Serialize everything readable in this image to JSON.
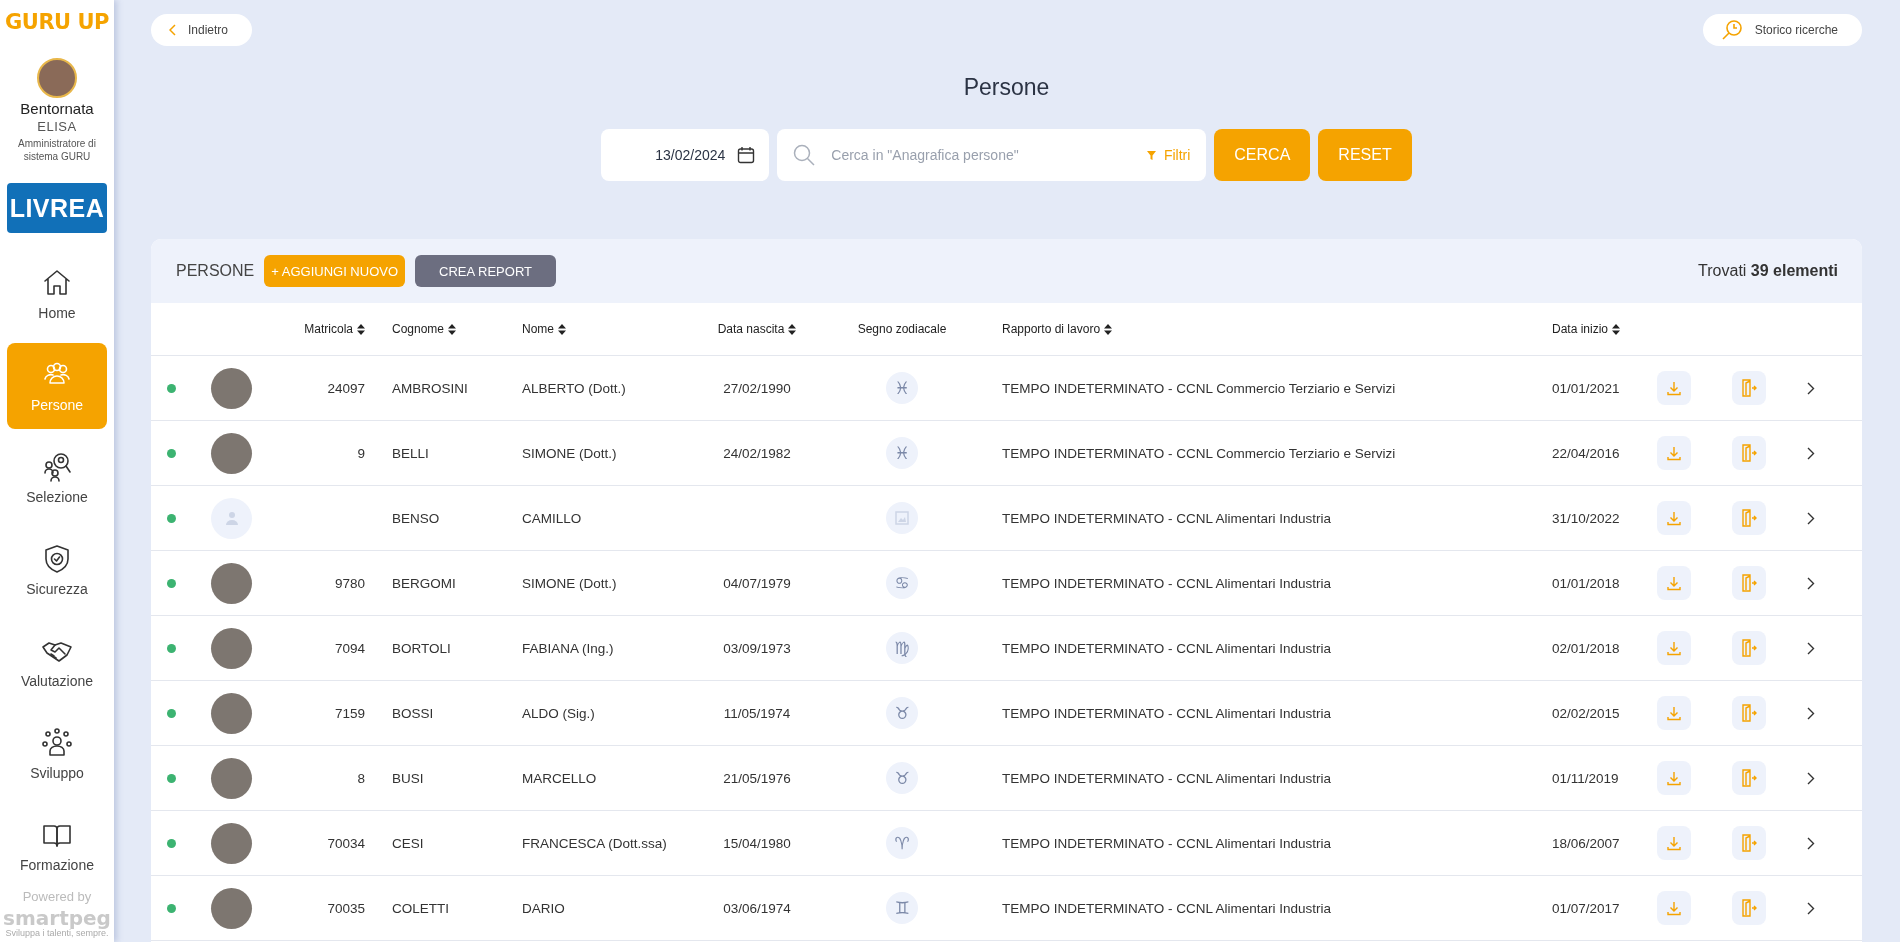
{
  "sidebar": {
    "logo": "GURU UP",
    "greeting": "Bentornata",
    "user_name": "ELISA",
    "user_role": "Amministratore di sistema GURU",
    "company_logo": "LIVREA",
    "items": [
      {
        "label": "Home",
        "kind": "home",
        "selected": false
      },
      {
        "label": "Persone",
        "kind": "people",
        "selected": true
      },
      {
        "label": "Selezione",
        "kind": "recruiting",
        "selected": false
      },
      {
        "label": "Sicurezza",
        "kind": "safety",
        "selected": false
      },
      {
        "label": "Valutazione",
        "kind": "evaluation",
        "selected": false
      },
      {
        "label": "Sviluppo",
        "kind": "development",
        "selected": false
      },
      {
        "label": "Formazione",
        "kind": "training",
        "selected": false
      }
    ],
    "powered_by": "Powered by",
    "brand": "smartpeg",
    "brand_tagline": "Sviluppa i talenti, sempre."
  },
  "top_bar": {
    "back": "Indietro",
    "history": "Storico ricerche"
  },
  "title": "Persone",
  "search": {
    "date": "13/02/2024",
    "placeholder": "Cerca in \"Anagrafica persone\"",
    "filters": "Filtri",
    "buttons": [
      "CERCA",
      "RESET"
    ]
  },
  "table": {
    "title": "PERSONE",
    "add_button": "+ AGGIUNGI NUOVO",
    "report_button": "CREA REPORT",
    "found": "Trovati **39 elementi**",
    "columns": [
      {
        "label": "Matricola",
        "sortable": true
      },
      {
        "label": "Cognome",
        "sortable": true
      },
      {
        "label": "Nome",
        "sortable": true
      },
      {
        "label": "Data nascita",
        "sortable": true
      },
      {
        "label": "Segno zodiacale",
        "sortable": false
      },
      {
        "label": "Rapporto di lavoro",
        "sortable": true
      },
      {
        "label": "Data inizio",
        "sortable": true
      }
    ],
    "rows": [
      {
        "active": true,
        "photo": true,
        "matricola": "24097",
        "cognome": "AMBROSINI",
        "nome": "ALBERTO (Dott.)",
        "data_nascita": "27/02/1990",
        "zodiac": "♓",
        "rapporto": "TEMPO INDETERMINATO - CCNL Commercio Terziario e Servizi",
        "data_inizio": "01/01/2021"
      },
      {
        "active": true,
        "photo": true,
        "matricola": "9",
        "cognome": "BELLI",
        "nome": "SIMONE (Dott.)",
        "data_nascita": "24/02/1982",
        "zodiac": "♓",
        "rapporto": "TEMPO INDETERMINATO - CCNL Commercio Terziario e Servizi",
        "data_inizio": "22/04/2016"
      },
      {
        "active": true,
        "photo": false,
        "cognome": "BENSO",
        "nome": "CAMILLO",
        "rapporto": "TEMPO INDETERMINATO - CCNL Alimentari Industria",
        "data_inizio": "31/10/2022"
      },
      {
        "active": true,
        "photo": true,
        "matricola": "9780",
        "cognome": "BERGOMI",
        "nome": "SIMONE (Dott.)",
        "data_nascita": "04/07/1979",
        "zodiac": "♋",
        "rapporto": "TEMPO INDETERMINATO - CCNL Alimentari Industria",
        "data_inizio": "01/01/2018"
      },
      {
        "active": true,
        "photo": true,
        "matricola": "7094",
        "cognome": "BORTOLI",
        "nome": "FABIANA (Ing.)",
        "data_nascita": "03/09/1973",
        "zodiac": "♍",
        "rapporto": "TEMPO INDETERMINATO - CCNL Alimentari Industria",
        "data_inizio": "02/01/2018"
      },
      {
        "active": true,
        "photo": true,
        "matricola": "7159",
        "cognome": "BOSSI",
        "nome": "ALDO (Sig.)",
        "data_nascita": "11/05/1974",
        "zodiac": "♉",
        "rapporto": "TEMPO INDETERMINATO - CCNL Alimentari Industria",
        "data_inizio": "02/02/2015"
      },
      {
        "active": true,
        "photo": true,
        "matricola": "8",
        "cognome": "BUSI",
        "nome": "MARCELLO",
        "data_nascita": "21/05/1976",
        "zodiac": "♉",
        "rapporto": "TEMPO INDETERMINATO - CCNL Alimentari Industria",
        "data_inizio": "01/11/2019"
      },
      {
        "active": true,
        "photo": true,
        "matricola": "70034",
        "cognome": "CESI",
        "nome": "FRANCESCA (Dott.ssa)",
        "data_nascita": "15/04/1980",
        "zodiac": "♈",
        "rapporto": "TEMPO INDETERMINATO - CCNL Alimentari Industria",
        "data_inizio": "18/06/2007"
      },
      {
        "active": true,
        "photo": true,
        "matricola": "70035",
        "cognome": "COLETTI",
        "nome": "DARIO",
        "data_nascita": "03/06/1974",
        "zodiac": "♊",
        "rapporto": "TEMPO INDETERMINATO - CCNL Alimentari Industria",
        "data_inizio": "01/07/2017"
      }
    ]
  }
}
